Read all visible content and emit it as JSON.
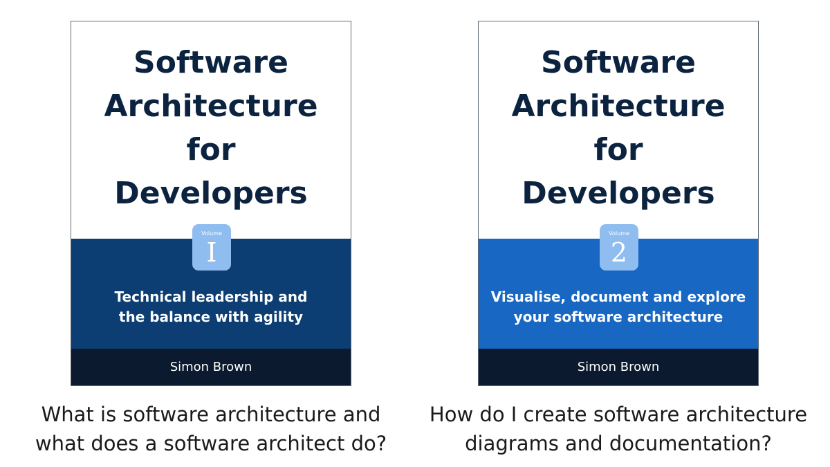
{
  "books": [
    {
      "title": "Software\nArchitecture\nfor\nDevelopers",
      "volume_label": "Volume",
      "volume_number": "I",
      "subtitle": "Technical leadership and\nthe balance with agility",
      "author": "Simon Brown",
      "band_color": "#0d3e73",
      "caption": "What is software architecture and\nwhat does a software architect do?"
    },
    {
      "title": "Software\nArchitecture\nfor\nDevelopers",
      "volume_label": "Volume",
      "volume_number": "2",
      "subtitle": "Visualise, document and explore\nyour software architecture",
      "author": "Simon Brown",
      "band_color": "#1767c3",
      "caption": "How do I create software architecture\ndiagrams and documentation?"
    }
  ],
  "colors": {
    "title_text": "#0c2340",
    "badge": "#8fbdf0",
    "author_bar": "#0b1a2e"
  }
}
